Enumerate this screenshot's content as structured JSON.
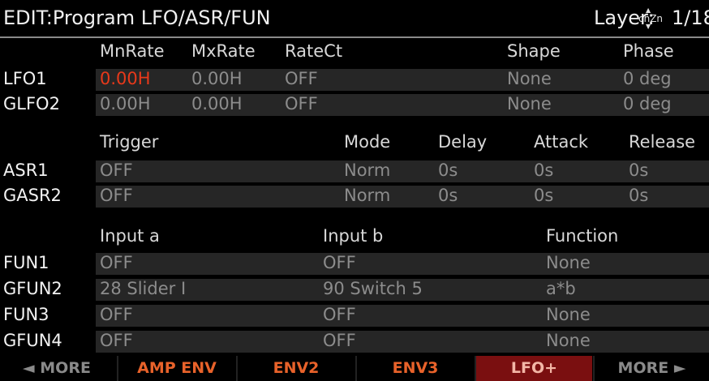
{
  "header": {
    "title": "EDIT:Program LFO/ASR/FUN",
    "chzn_label": "chZn",
    "layer_label": "Layer:",
    "layer_value": "1/18"
  },
  "lfo": {
    "columns": [
      "MnRate",
      "MxRate",
      "RateCt",
      "Shape",
      "Phase"
    ],
    "rows": [
      {
        "name": "LFO1",
        "mnrate": "0.00H",
        "mxrate": "0.00H",
        "ratect": "OFF",
        "shape": "None",
        "phase": "0 deg"
      },
      {
        "name": "GLFO2",
        "mnrate": "0.00H",
        "mxrate": "0.00H",
        "ratect": "OFF",
        "shape": "None",
        "phase": "0 deg"
      }
    ]
  },
  "asr": {
    "columns": [
      "Trigger",
      "Mode",
      "Delay",
      "Attack",
      "Release"
    ],
    "rows": [
      {
        "name": "ASR1",
        "trigger": "OFF",
        "mode": "Norm",
        "delay": "0s",
        "attack": "0s",
        "release": "0s"
      },
      {
        "name": "GASR2",
        "trigger": "OFF",
        "mode": "Norm",
        "delay": "0s",
        "attack": "0s",
        "release": "0s"
      }
    ]
  },
  "fun": {
    "columns": [
      "Input a",
      "Input b",
      "Function"
    ],
    "rows": [
      {
        "name": "FUN1",
        "input_a": "OFF",
        "input_b": "OFF",
        "function": "None"
      },
      {
        "name": "GFUN2",
        "input_a": "28 Slider I",
        "input_b": "90 Switch 5",
        "function": "a*b"
      },
      {
        "name": "FUN3",
        "input_a": "OFF",
        "input_b": "OFF",
        "function": "None"
      },
      {
        "name": "GFUN4",
        "input_a": "OFF",
        "input_b": "OFF",
        "function": "None"
      }
    ]
  },
  "softbuttons": [
    {
      "label": "◄ MORE",
      "state": "more"
    },
    {
      "label": "AMP ENV",
      "state": "off"
    },
    {
      "label": "ENV2",
      "state": "off"
    },
    {
      "label": "ENV3",
      "state": "off"
    },
    {
      "label": "LFO+",
      "state": "on"
    },
    {
      "label": "MORE ►",
      "state": "more"
    }
  ],
  "colors": {
    "background": "#000000",
    "selected_value": "#e8391a",
    "dim_value": "#8c8c8c",
    "active_button": "#7a0f10",
    "button_text": "#e8622a"
  }
}
